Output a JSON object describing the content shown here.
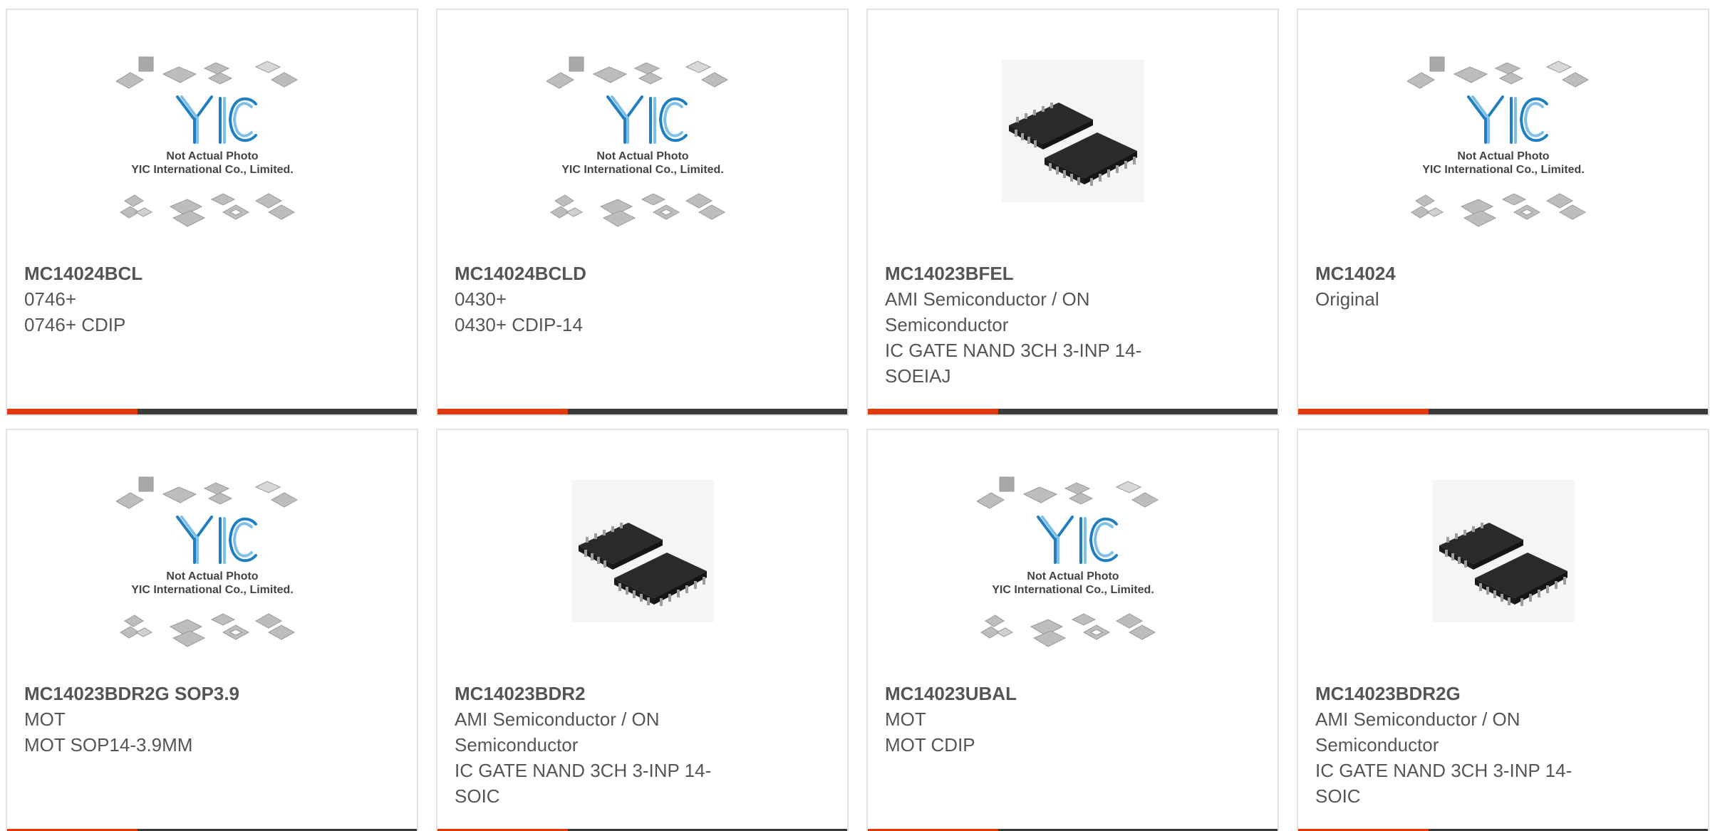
{
  "products": [
    {
      "title": "MC14024BCL",
      "lines": [
        "0746+",
        "0746+ CDIP"
      ],
      "image": "placeholder"
    },
    {
      "title": "MC14024BCLD",
      "lines": [
        "0430+",
        "0430+ CDIP-14"
      ],
      "image": "placeholder"
    },
    {
      "title": "MC14023BFEL",
      "lines": [
        "AMI Semiconductor / ON",
        "Semiconductor",
        "IC GATE NAND 3CH 3-INP 14-",
        "SOEIAJ"
      ],
      "image": "chip"
    },
    {
      "title": "MC14024",
      "lines": [
        "Original"
      ],
      "image": "placeholder"
    },
    {
      "title": "MC14023BDR2G SOP3.9",
      "lines": [
        "MOT",
        "MOT SOP14-3.9MM"
      ],
      "image": "placeholder"
    },
    {
      "title": "MC14023BDR2",
      "lines": [
        "AMI Semiconductor / ON",
        "Semiconductor",
        "IC GATE NAND 3CH 3-INP 14-",
        "SOIC"
      ],
      "image": "chip"
    },
    {
      "title": "MC14023UBAL",
      "lines": [
        "MOT",
        "MOT CDIP"
      ],
      "image": "placeholder"
    },
    {
      "title": "MC14023BDR2G",
      "lines": [
        "AMI Semiconductor / ON",
        "Semiconductor",
        "IC GATE NAND 3CH 3-INP 14-",
        "SOIC"
      ],
      "image": "chip"
    }
  ],
  "placeholder": {
    "brand": "YIC",
    "caption_line1": "Not Actual Photo",
    "caption_line2": "YIC International Co., Limited."
  },
  "colors": {
    "accent": "#e03a0f",
    "bar": "#3a3a3a",
    "brand_blue": "#1f7fc0",
    "text": "#555555"
  }
}
